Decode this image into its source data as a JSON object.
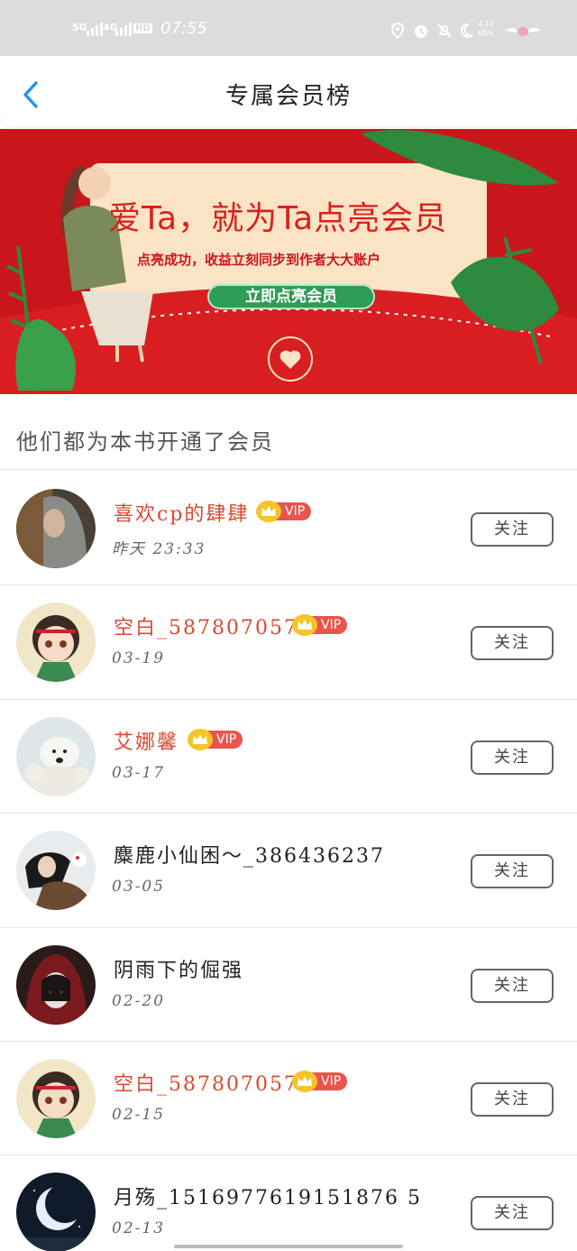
{
  "status_bar": {
    "signal1": "5G",
    "signal2": "4G",
    "hd": "HD",
    "time": "07:55",
    "speed_value": "4.10",
    "speed_unit": "KB/s"
  },
  "nav": {
    "title": "专属会员榜"
  },
  "banner": {
    "headline": "爱Ta，就为Ta点亮会员",
    "subtitle": "点亮成功，收益立刻同步到作者大大账户",
    "cta_label": "立即点亮会员"
  },
  "section_title": "他们都为本书开通了会员",
  "vip_label": "VIP",
  "follow_label": "关注",
  "members": [
    {
      "name": "喜欢cp的肆肆",
      "date": "昨天 23:33",
      "vip": true,
      "avatar": "avatar-grey-hair"
    },
    {
      "name": "空白_587807057",
      "date": "03-19",
      "vip": true,
      "avatar": "avatar-cartoon-girl"
    },
    {
      "name": "艾娜馨",
      "date": "03-17",
      "vip": true,
      "avatar": "avatar-polar-bear"
    },
    {
      "name": "麋鹿小仙困～_386436237",
      "date": "03-05",
      "vip": false,
      "avatar": "avatar-girl-horse"
    },
    {
      "name": "阴雨下的倔强",
      "date": "02-20",
      "vip": false,
      "avatar": "avatar-red-hood"
    },
    {
      "name": "空白_587807057",
      "date": "02-15",
      "vip": true,
      "avatar": "avatar-cartoon-girl"
    },
    {
      "name": "月殇_1516977619151876 5",
      "date": "02-13",
      "vip": false,
      "avatar": "avatar-moon-night"
    }
  ],
  "colors": {
    "banner_red": "#c9161b",
    "vip_name": "#d84a2f",
    "vip_badge": "#e8554e",
    "crown": "#f4c42a",
    "back_arrow": "#2196f3",
    "cta_green": "#2f9c57"
  }
}
